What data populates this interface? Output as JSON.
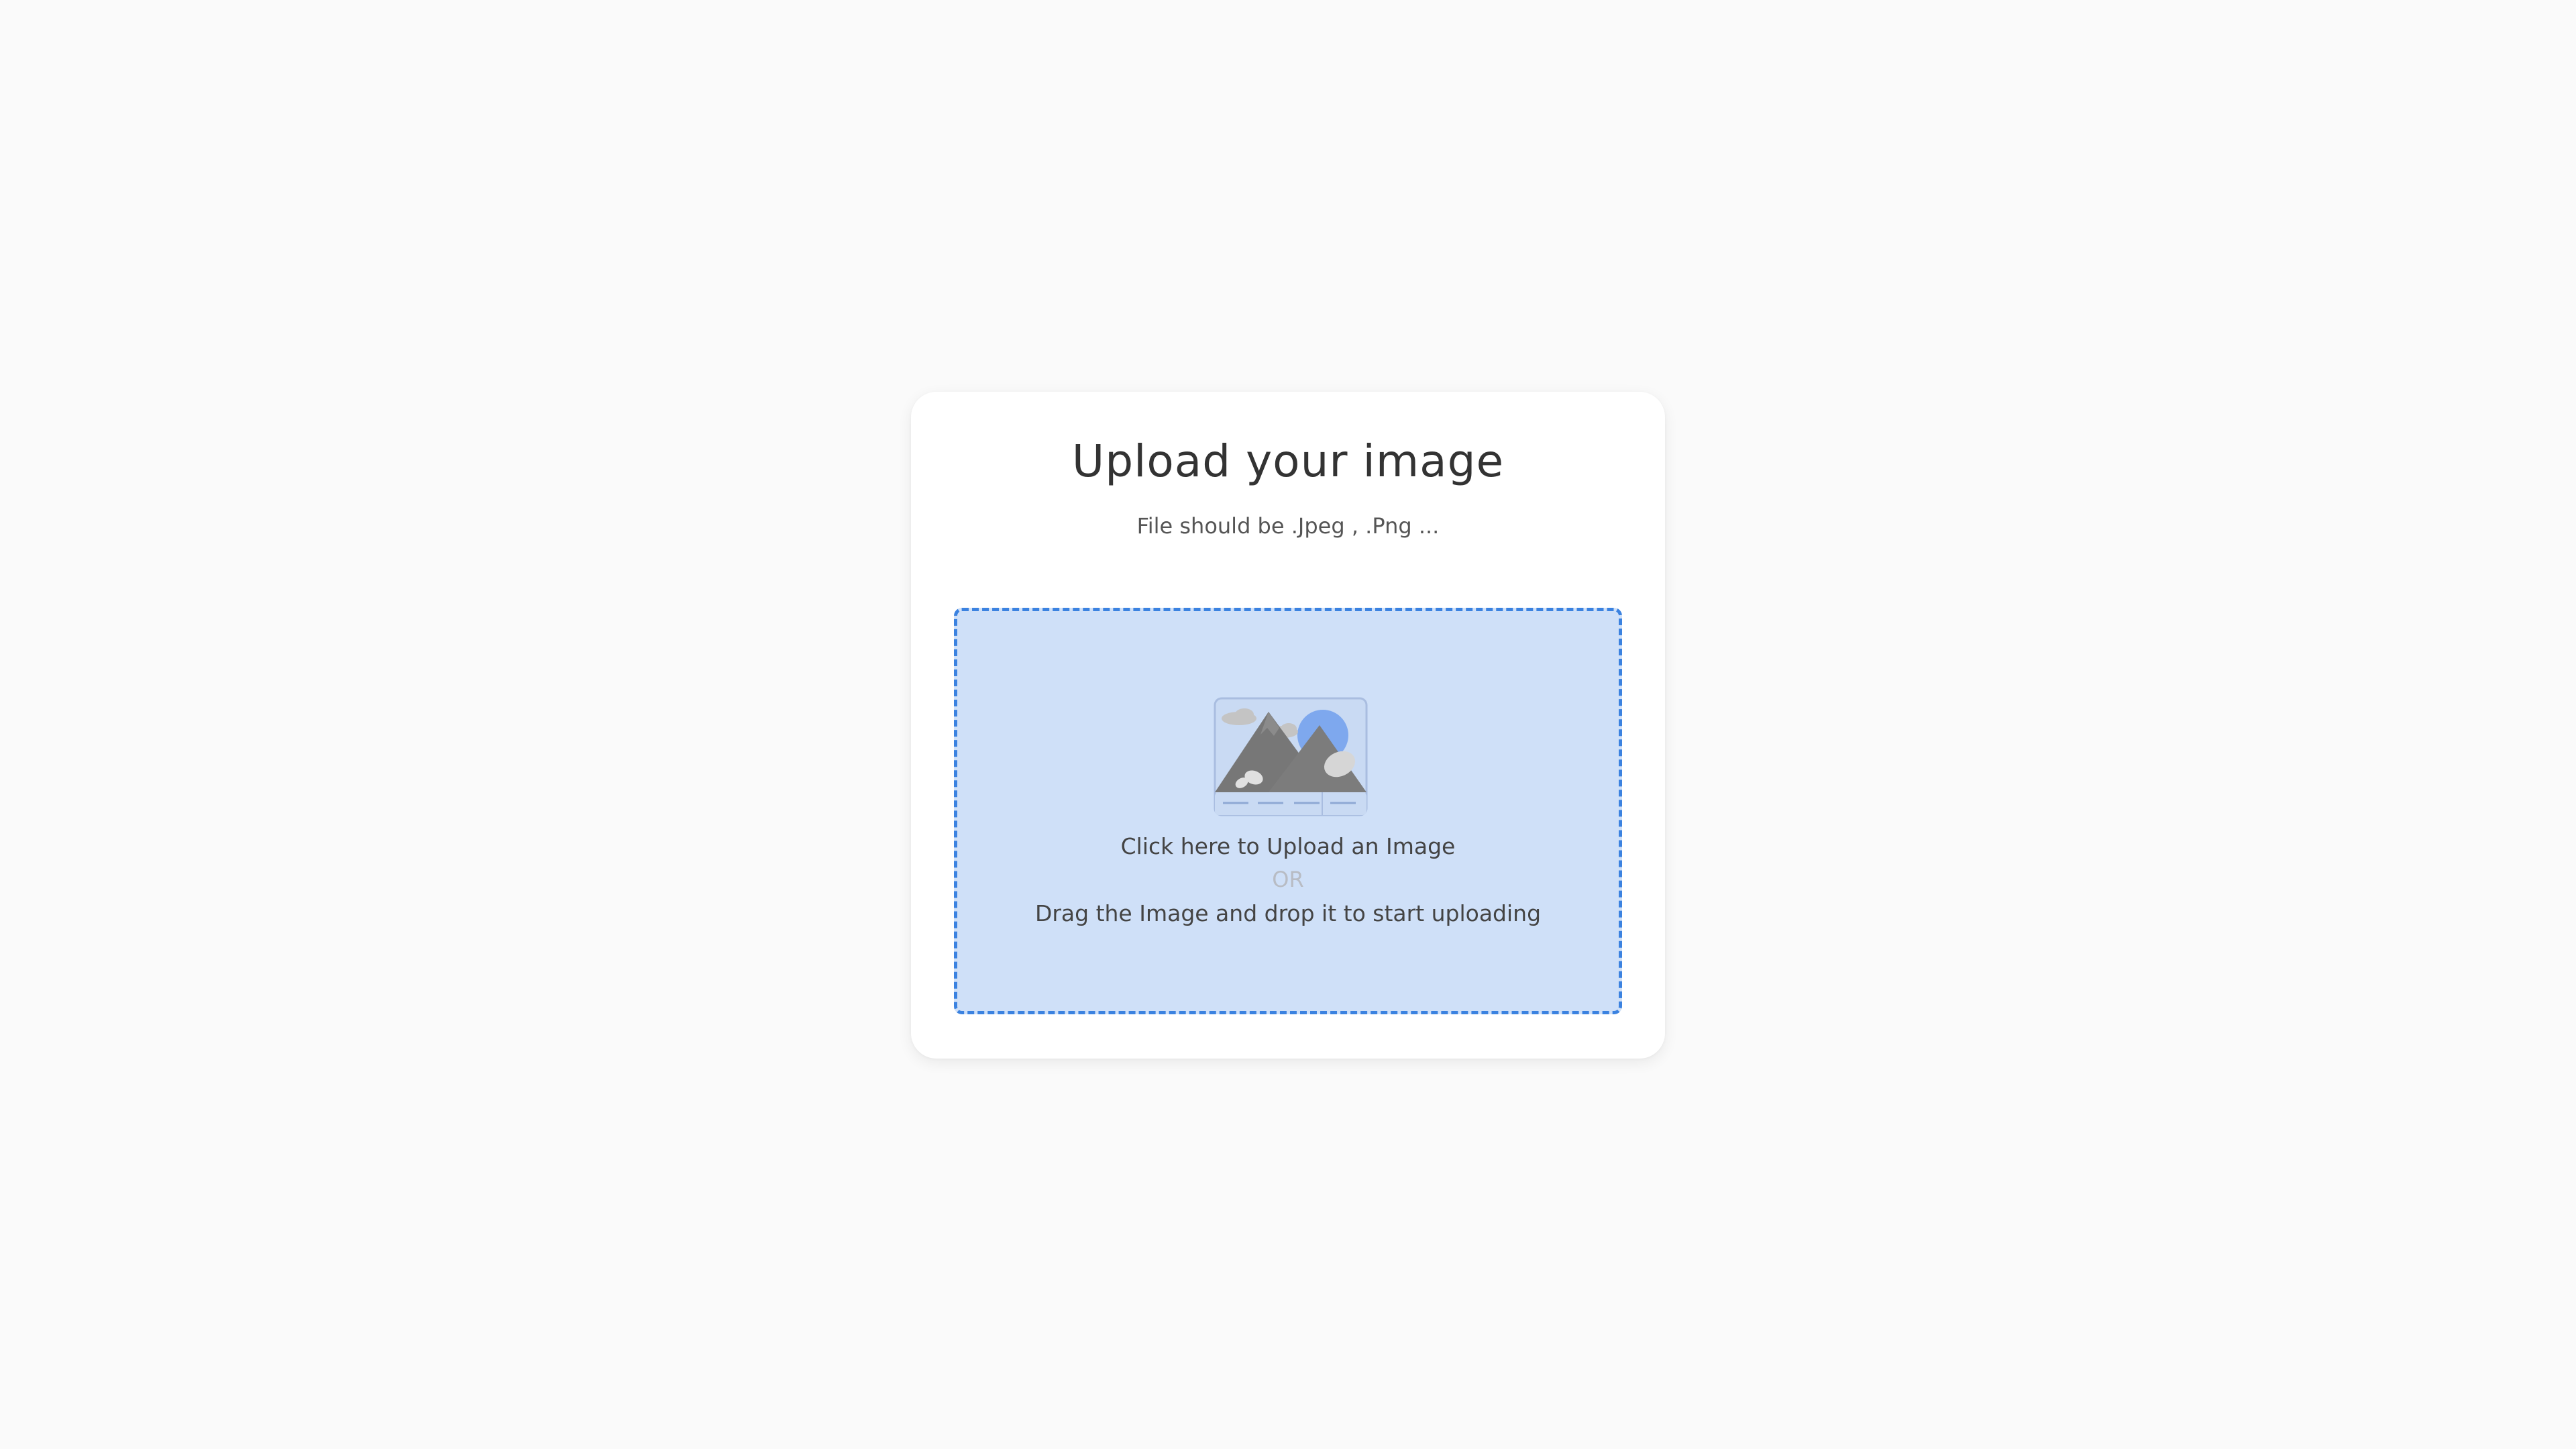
{
  "card": {
    "title": "Upload your image",
    "subtitle": "File should be .Jpeg , .Png ..."
  },
  "dropzone": {
    "illustration_icon": "mountain-image-icon",
    "click_text": "Click here to Upload an Image",
    "or_text": "OR",
    "drag_text": "Drag the Image and drop it to start uploading"
  },
  "colors": {
    "page_background": "#fafafa",
    "card_background": "#ffffff",
    "dropzone_background": "#cfe0f8",
    "dropzone_border": "#3b82e0",
    "title_text": "#333333"
  }
}
